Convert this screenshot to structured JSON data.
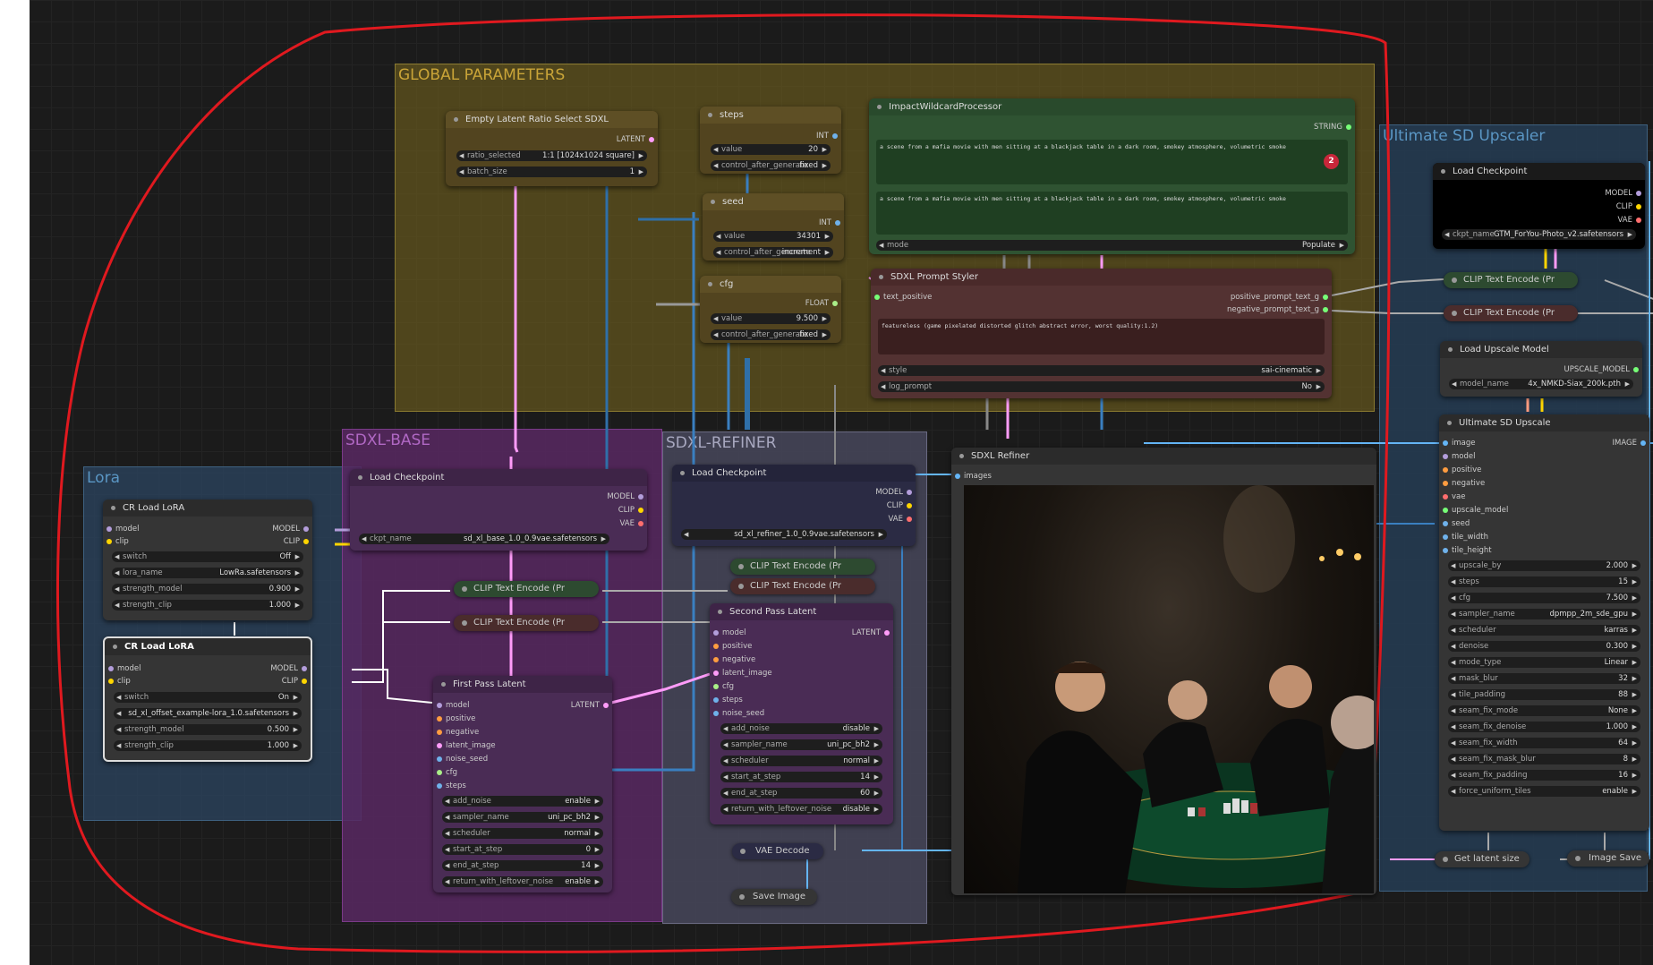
{
  "colors": {
    "model": "#b39ddb",
    "clip": "#ffd500",
    "vae": "#ff6e6e",
    "latent": "#ff9cf9",
    "int": "#6fb1ea",
    "float": "#aaee88",
    "string": "#77ff77",
    "image": "#64b5f6",
    "annotation": "#e0191f"
  },
  "groups": {
    "global": "GLOBAL PARAMETERS",
    "lora": "Lora",
    "base": "SDXL-BASE",
    "refiner": "SDXL-REFINER",
    "upscaler": "Ultimate SD Upscaler"
  },
  "common": {
    "model": "model",
    "clip": "clip",
    "vae": "vae",
    "positive": "positive",
    "negative": "negative",
    "latent_image": "latent_image",
    "noise_seed": "noise_seed",
    "cfg": "cfg",
    "steps": "steps",
    "MODEL": "MODEL",
    "CLIP": "CLIP",
    "VAE": "VAE",
    "LATENT": "LATENT",
    "INT": "INT",
    "FLOAT": "FLOAT",
    "STRING": "STRING",
    "IMAGE": "IMAGE",
    "images": "images",
    "image": "image",
    "upscale_model": "upscale_model",
    "seed": "seed",
    "tile_width": "tile_width",
    "tile_height": "tile_height",
    "text_positive": "text_positive",
    "value": "value",
    "ckpt_name": "ckpt_name"
  },
  "empty_latent": {
    "title": "Empty Latent Ratio Select SDXL",
    "ratio_selected": "ratio_selected",
    "ratio_value": "1:1 [1024x1024 square]",
    "batch_size": "batch_size",
    "batch_value": "1"
  },
  "steps_node": {
    "title": "steps",
    "value": "20",
    "control_label": "control_after_generate",
    "control_value": "fixed"
  },
  "seed_node": {
    "title": "seed",
    "value": "34301",
    "control_label": "control_after_generate",
    "control_value": "increment"
  },
  "cfg_node": {
    "title": "cfg",
    "value": "9.500",
    "control_label": "control_after_generate",
    "control_value": "fixed"
  },
  "wildcard": {
    "title": "ImpactWildcardProcessor",
    "text1": "a scene from a mafia movie with men sitting at a blackjack table in a dark room, smokey atmosphere, volumetric smoke",
    "text2": "a scene from a mafia movie with men sitting at a blackjack table in a dark room, smokey atmosphere, volumetric smoke",
    "badge": "2",
    "mode_label": "mode",
    "mode_value": "Populate"
  },
  "styler": {
    "title": "SDXL Prompt Styler",
    "out1": "positive_prompt_text_g",
    "out2": "negative_prompt_text_g",
    "text": "featureless (game pixelated distorted glitch abstract error, worst quality:1.2)",
    "style_label": "style",
    "style_value": "sai-cinematic",
    "log_label": "log_prompt",
    "log_value": "No"
  },
  "lora1": {
    "title": "CR Load LoRA",
    "switch_label": "switch",
    "switch_value": "Off",
    "lora_label": "lora_name",
    "lora_value": "LowRa.safetensors",
    "sm_label": "strength_model",
    "sm_value": "0.900",
    "sc_label": "strength_clip",
    "sc_value": "1.000"
  },
  "lora2": {
    "title": "CR Load LoRA",
    "switch_label": "switch",
    "switch_value": "On",
    "lora_label": "lora_name",
    "lora_value": "sd_xl_offset_example-lora_1.0.safetensors",
    "sm_label": "strength_model",
    "sm_value": "0.500",
    "sc_label": "strength_clip",
    "sc_value": "1.000"
  },
  "base_ckpt": {
    "title": "Load Checkpoint",
    "ckpt_value": "sd_xl_base_1.0_0.9vae.safetensors"
  },
  "clip_base1": "CLIP Text Encode (Pr",
  "clip_base2": "CLIP Text Encode (Pr",
  "first_pass": {
    "title": "First Pass Latent",
    "widgets": [
      {
        "label": "add_noise",
        "value": "enable"
      },
      {
        "label": "sampler_name",
        "value": "uni_pc_bh2"
      },
      {
        "label": "scheduler",
        "value": "normal"
      },
      {
        "label": "start_at_step",
        "value": "0"
      },
      {
        "label": "end_at_step",
        "value": "14"
      },
      {
        "label": "return_with_leftover_noise",
        "value": "enable"
      }
    ]
  },
  "refiner_ckpt": {
    "title": "Load Checkpoint",
    "ckpt_value": "sd_xl_refiner_1.0_0.9vae.safetensors"
  },
  "clip_ref1": "CLIP Text Encode (Pr",
  "clip_ref2": "CLIP Text Encode (Pr",
  "second_pass": {
    "title": "Second Pass Latent",
    "widgets": [
      {
        "label": "add_noise",
        "value": "disable"
      },
      {
        "label": "sampler_name",
        "value": "uni_pc_bh2"
      },
      {
        "label": "scheduler",
        "value": "normal"
      },
      {
        "label": "start_at_step",
        "value": "14"
      },
      {
        "label": "end_at_step",
        "value": "60"
      },
      {
        "label": "return_with_leftover_noise",
        "value": "disable"
      }
    ]
  },
  "vae_decode": "VAE Decode",
  "save_image": "Save Image",
  "sdxl_refiner": {
    "title": "SDXL Refiner"
  },
  "up_ckpt": {
    "title": "Load Checkpoint",
    "ckpt_value": "GTM_ForYou-Photo_v2.safetensors"
  },
  "clip_up1": "CLIP Text Encode (Pr",
  "clip_up2": "CLIP Text Encode (Pr",
  "upscale_model": {
    "title": "Load Upscale Model",
    "out": "UPSCALE_MODEL",
    "model_label": "model_name",
    "model_value": "4x_NMKD-Siax_200k.pth"
  },
  "ultimate": {
    "title": "Ultimate SD Upscale",
    "widgets": [
      {
        "label": "upscale_by",
        "value": "2.000"
      },
      {
        "label": "steps",
        "value": "15"
      },
      {
        "label": "cfg",
        "value": "7.500"
      },
      {
        "label": "sampler_name",
        "value": "dpmpp_2m_sde_gpu"
      },
      {
        "label": "scheduler",
        "value": "karras"
      },
      {
        "label": "denoise",
        "value": "0.300"
      },
      {
        "label": "mode_type",
        "value": "Linear"
      },
      {
        "label": "mask_blur",
        "value": "32"
      },
      {
        "label": "tile_padding",
        "value": "88"
      },
      {
        "label": "seam_fix_mode",
        "value": "None"
      },
      {
        "label": "seam_fix_denoise",
        "value": "1.000"
      },
      {
        "label": "seam_fix_width",
        "value": "64"
      },
      {
        "label": "seam_fix_mask_blur",
        "value": "8"
      },
      {
        "label": "seam_fix_padding",
        "value": "16"
      },
      {
        "label": "force_uniform_tiles",
        "value": "enable"
      }
    ]
  },
  "get_latent": "Get latent size",
  "image_save": "Image Save"
}
